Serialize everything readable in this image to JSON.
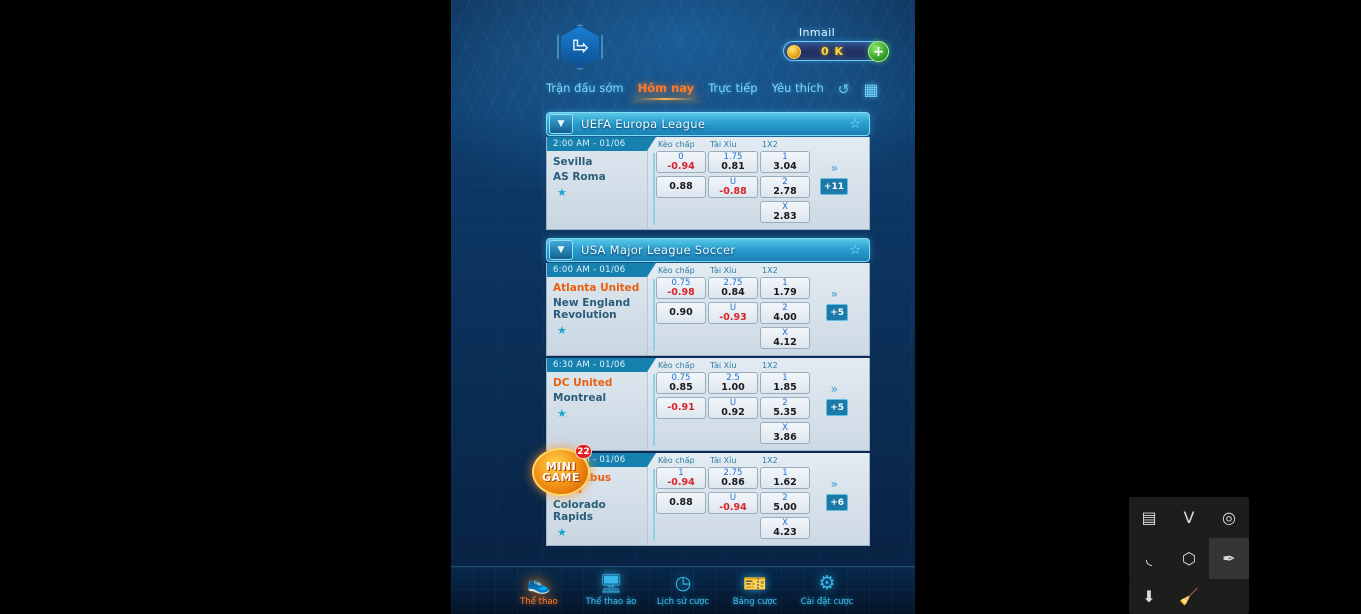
{
  "header": {
    "logo_icon": "hex-logo-icon",
    "inmail_label": "Inmail",
    "balance_amount": "0 K",
    "coin_icon": "coin-icon",
    "plus_label": "+"
  },
  "tabs": {
    "items": [
      {
        "label": "Trận đấu sớm",
        "active": false
      },
      {
        "label": "Hôm nay",
        "active": true
      },
      {
        "label": "Trực tiếp",
        "active": false
      },
      {
        "label": "Yêu thích",
        "active": false
      }
    ],
    "refresh_icon": "↺",
    "calendar_icon": "▦"
  },
  "odds_headers": {
    "handicap": "Kèo chấp",
    "overunder": "Tài Xỉu",
    "onextwo": "1X2"
  },
  "leagues": [
    {
      "name": "UEFA Europa League",
      "caret_icon": "▼",
      "star_icon": "☆",
      "matches": [
        {
          "time": "2:00 AM  - 01/06",
          "home": "Sevilla",
          "away": "AS Roma",
          "fav_icon": "★",
          "home_highlight": false,
          "handicap": [
            {
              "top": "0",
              "bottom": "-0.94",
              "neg": true
            },
            {
              "top": "",
              "bottom": "0.88",
              "neg": false
            }
          ],
          "overunder": [
            {
              "top": "1.75",
              "bottom": "0.81",
              "neg": false
            },
            {
              "top": "U",
              "bottom": "-0.88",
              "neg": true
            }
          ],
          "onextwo": [
            {
              "top": "1",
              "bottom": "3.04",
              "neg": false
            },
            {
              "top": "2",
              "bottom": "2.78",
              "neg": false
            },
            {
              "top": "X",
              "bottom": "2.83",
              "neg": false
            }
          ],
          "chevron": "»",
          "more_count": "+11"
        }
      ]
    },
    {
      "name": "USA Major League Soccer",
      "caret_icon": "▼",
      "star_icon": "☆",
      "matches": [
        {
          "time": "6:00 AM  - 01/06",
          "home": "Atlanta United",
          "away": "New England Revolution",
          "fav_icon": "★",
          "home_highlight": true,
          "handicap": [
            {
              "top": "0.75",
              "bottom": "-0.98",
              "neg": true
            },
            {
              "top": "",
              "bottom": "0.90",
              "neg": false
            }
          ],
          "overunder": [
            {
              "top": "2.75",
              "bottom": "0.84",
              "neg": false
            },
            {
              "top": "U",
              "bottom": "-0.93",
              "neg": true
            }
          ],
          "onextwo": [
            {
              "top": "1",
              "bottom": "1.79",
              "neg": false
            },
            {
              "top": "2",
              "bottom": "4.00",
              "neg": false
            },
            {
              "top": "X",
              "bottom": "4.12",
              "neg": false
            }
          ],
          "chevron": "»",
          "more_count": "+5"
        },
        {
          "time": "6:30 AM  - 01/06",
          "home": "DC United",
          "away": "Montreal",
          "fav_icon": "★",
          "home_highlight": true,
          "handicap": [
            {
              "top": "0.75",
              "bottom": "0.85",
              "neg": false
            },
            {
              "top": "",
              "bottom": "-0.91",
              "neg": true
            }
          ],
          "overunder": [
            {
              "top": "2.5",
              "bottom": "1.00",
              "neg": false
            },
            {
              "top": "U",
              "bottom": "0.92",
              "neg": false
            }
          ],
          "onextwo": [
            {
              "top": "1",
              "bottom": "1.85",
              "neg": false
            },
            {
              "top": "2",
              "bottom": "5.35",
              "neg": false
            },
            {
              "top": "X",
              "bottom": "3.86",
              "neg": false
            }
          ],
          "chevron": "»",
          "more_count": "+5"
        },
        {
          "time": "7:00 AM  - 01/06",
          "home": "Columbus Crew",
          "away": "Colorado Rapids",
          "fav_icon": "★",
          "home_highlight": true,
          "handicap": [
            {
              "top": "1",
              "bottom": "-0.94",
              "neg": true
            },
            {
              "top": "",
              "bottom": "0.88",
              "neg": false
            }
          ],
          "overunder": [
            {
              "top": "2.75",
              "bottom": "0.86",
              "neg": false
            },
            {
              "top": "U",
              "bottom": "-0.94",
              "neg": true
            }
          ],
          "onextwo": [
            {
              "top": "1",
              "bottom": "1.62",
              "neg": false
            },
            {
              "top": "2",
              "bottom": "5.00",
              "neg": false
            },
            {
              "top": "X",
              "bottom": "4.23",
              "neg": false
            }
          ],
          "chevron": "»",
          "more_count": "+6"
        }
      ]
    }
  ],
  "minigame": {
    "line1": "MINI",
    "line2": "GAME",
    "count": "22"
  },
  "bottom_nav": [
    {
      "label": "Thể thao",
      "icon": "soccer-shoe-icon",
      "glyph": "👟",
      "active": true
    },
    {
      "label": "Thể thao ảo",
      "icon": "virtual-sports-monitor-icon",
      "glyph": "🖥",
      "active": false
    },
    {
      "label": "Lịch sử cược",
      "icon": "bet-history-clock-icon",
      "glyph": "◷",
      "active": false
    },
    {
      "label": "Bảng cược",
      "icon": "bet-slip-icon",
      "glyph": "🎫",
      "active": false
    },
    {
      "label": "Cài đặt cược",
      "icon": "bet-settings-gear-icon",
      "glyph": "⚙",
      "active": false
    }
  ],
  "dock": {
    "row1": [
      {
        "icon": "network-drive-icon",
        "glyph": "▤",
        "selected": false
      },
      {
        "icon": "letter-v-icon",
        "glyph": "V",
        "selected": false
      },
      {
        "icon": "blue-double-circle-icon",
        "glyph": "◎",
        "selected": false
      }
    ],
    "row2": [
      {
        "icon": "wifi-signal-icon",
        "glyph": "◟",
        "selected": false
      },
      {
        "icon": "hexagon-chart-icon",
        "glyph": "⬡",
        "selected": false
      },
      {
        "icon": "purple-feather-icon",
        "glyph": "✒",
        "selected": true
      }
    ],
    "row3": [
      {
        "icon": "green-download-arrow-icon",
        "glyph": "⬇",
        "selected": false
      },
      {
        "icon": "cleaner-brush-icon",
        "glyph": "🧹",
        "selected": false
      },
      {
        "icon": "empty-slot",
        "glyph": "",
        "selected": false
      }
    ]
  },
  "colors": {
    "accent_orange": "#ff7a29",
    "cyan": "#3fc0ec",
    "time_bar": "#1680ae",
    "negative_red": "#d8232a",
    "odd_blue": "#1f6fd0"
  }
}
